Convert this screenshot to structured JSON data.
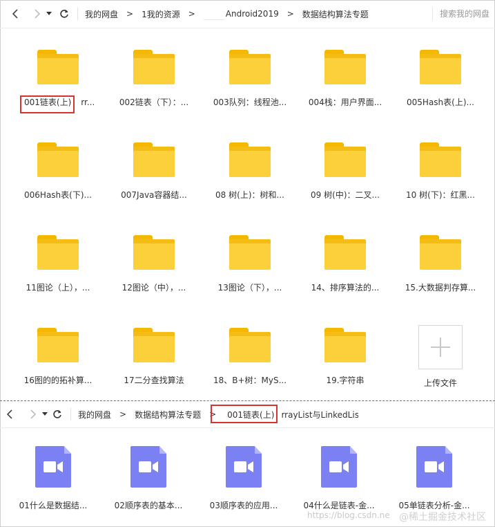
{
  "top_bar": {
    "crumbs": [
      "我的网盘",
      "1我的资源",
      "Android2019",
      "数据结构算法专题"
    ],
    "separator": ">",
    "search_placeholder": "搜索我的网盘"
  },
  "folders": [
    "001链表(上)",
    "rr...",
    "002链表（下）：...",
    "003队列：线程池...",
    "004栈：用户界面...",
    "005Hash表(上)...",
    "006Hash表(下)...",
    "007Java容器结...",
    "08 树(上)：树和...",
    "09 树(中)：二叉...",
    "10 树(下)：红黑...",
    "11图论（上），...",
    "12图论（中），...",
    "13图论（下），...",
    "14、排序算法的...",
    "15.大数据判存算...",
    "16图的的拓补算...",
    "17二分查找算法",
    "18、B+树：MyS...",
    "19.字符串"
  ],
  "upload_label": "上传文件",
  "bottom_bar": {
    "crumbs": [
      "我的网盘",
      "数据结构算法专题",
      "001链表(上)",
      "rrayList与LinkedList"
    ],
    "separator": ">"
  },
  "videos": [
    "01什么是数据结...",
    "02顺序表的基本...",
    "03顺序表的应用...",
    "04什么是链表-金...",
    "05单链表分析-金..."
  ],
  "watermark": "https://blog.csdn.ne",
  "watermark2": "@稀土掘金技术社区",
  "colors": {
    "folder": "#fcd03b",
    "video": "#7b81f3",
    "highlight": "#d9322e",
    "divider": "#1a8fa3"
  },
  "icons": [
    "back-icon",
    "forward-icon",
    "dropdown-icon",
    "refresh-icon",
    "folder-icon",
    "video-icon",
    "plus-icon"
  ]
}
